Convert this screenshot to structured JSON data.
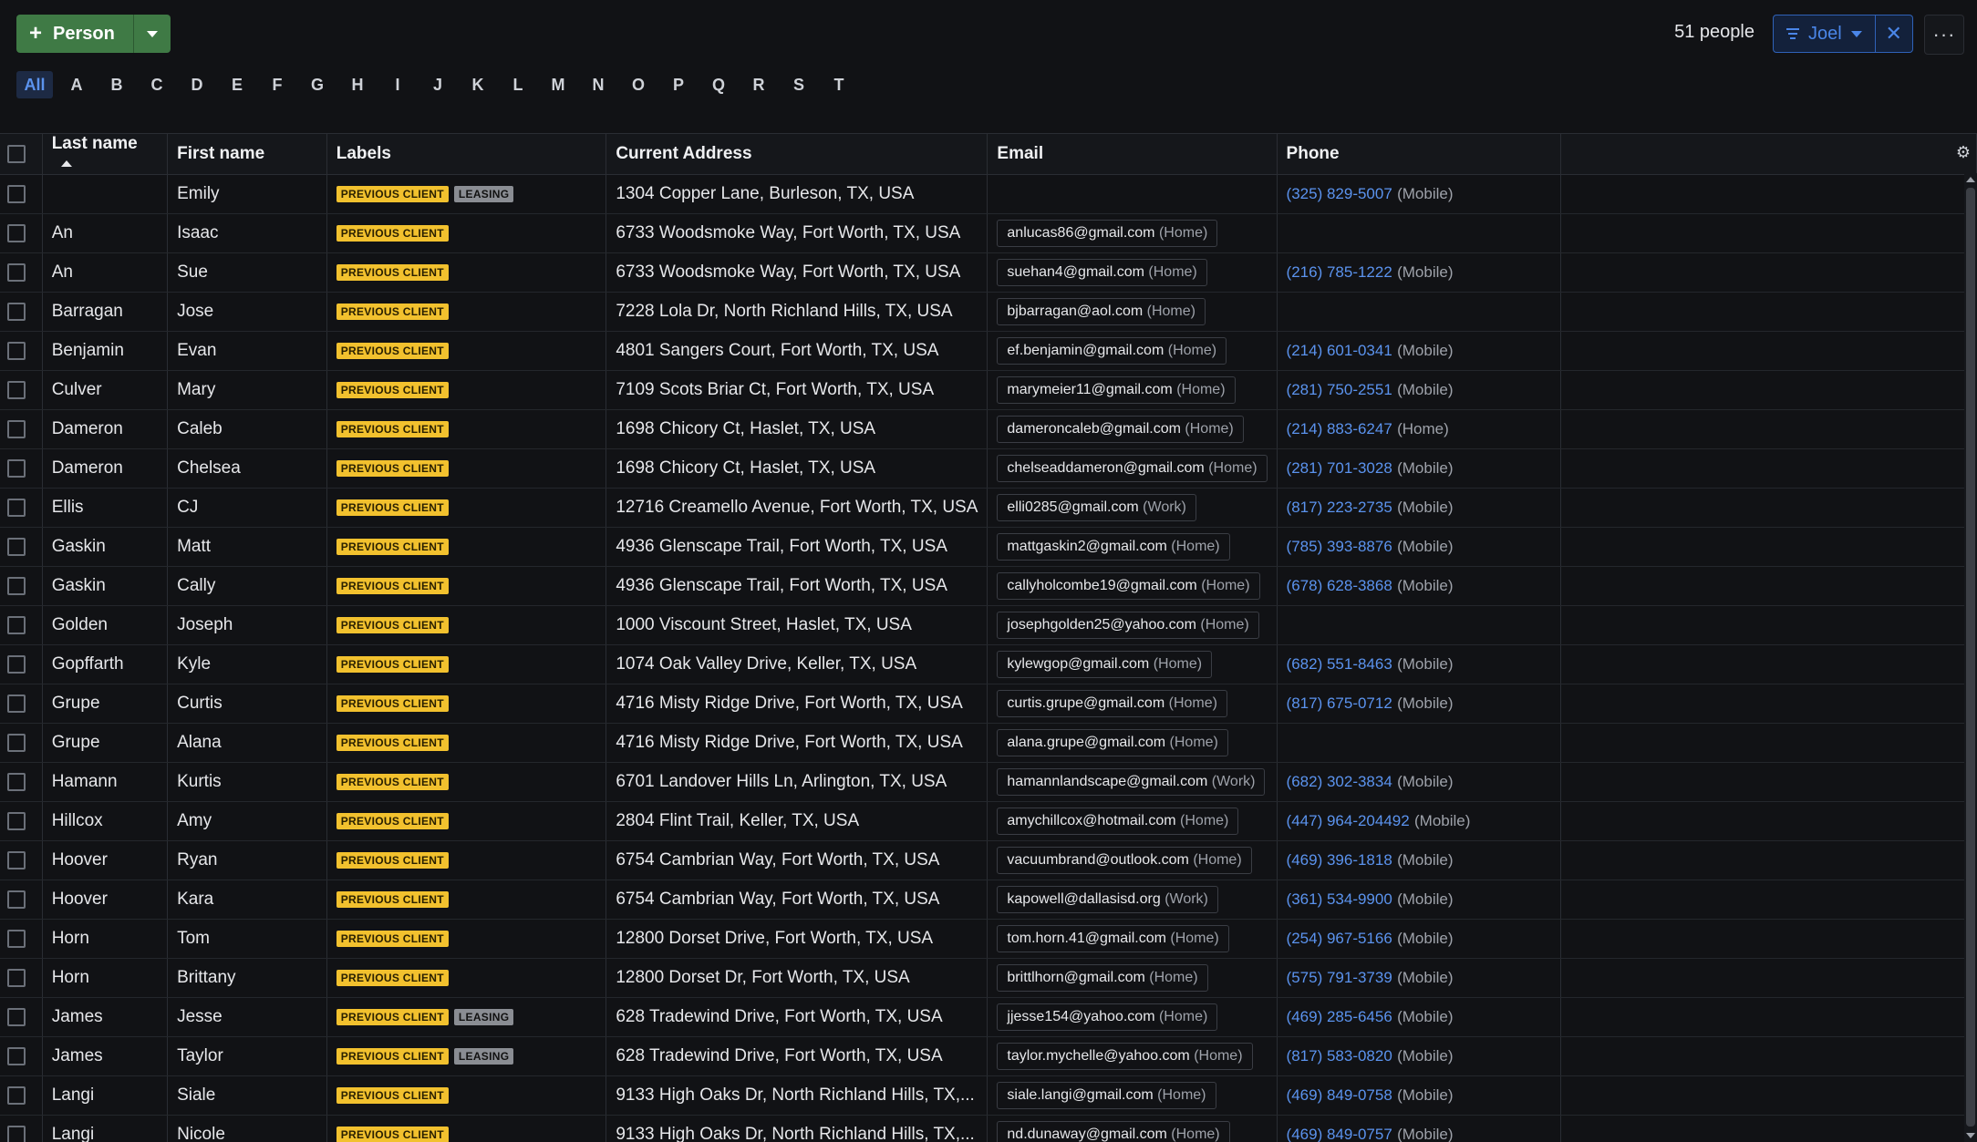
{
  "toolbar": {
    "add_person_label": "Person",
    "people_count": "51 people",
    "filter_label": "Joel",
    "clear_label": "✕",
    "more_label": "···"
  },
  "alphabet": [
    "All",
    "A",
    "B",
    "C",
    "D",
    "E",
    "F",
    "G",
    "H",
    "I",
    "J",
    "K",
    "L",
    "M",
    "N",
    "O",
    "P",
    "Q",
    "R",
    "S",
    "T"
  ],
  "alphabet_active": "All",
  "columns": {
    "last_name": "Last name",
    "first_name": "First name",
    "labels": "Labels",
    "address": "Current Address",
    "email": "Email",
    "phone": "Phone"
  },
  "rows": [
    {
      "last": "",
      "first": "Emily",
      "labels": [
        "PREVIOUS CLIENT",
        "LEASING"
      ],
      "address": "1304 Copper Lane, Burleson, TX, USA",
      "email": "",
      "email_type": "",
      "phone": "(325) 829-5007",
      "phone_type": "(Mobile)"
    },
    {
      "last": "An",
      "first": "Isaac",
      "labels": [
        "PREVIOUS CLIENT"
      ],
      "address": "6733 Woodsmoke Way, Fort Worth, TX, USA",
      "email": "anlucas86@gmail.com",
      "email_type": "(Home)",
      "phone": "",
      "phone_type": ""
    },
    {
      "last": "An",
      "first": "Sue",
      "labels": [
        "PREVIOUS CLIENT"
      ],
      "address": "6733 Woodsmoke Way, Fort Worth, TX, USA",
      "email": "suehan4@gmail.com",
      "email_type": "(Home)",
      "phone": "(216) 785-1222",
      "phone_type": "(Mobile)"
    },
    {
      "last": "Barragan",
      "first": "Jose",
      "labels": [
        "PREVIOUS CLIENT"
      ],
      "address": "7228 Lola Dr, North Richland Hills, TX, USA",
      "email": "bjbarragan@aol.com",
      "email_type": "(Home)",
      "phone": "",
      "phone_type": ""
    },
    {
      "last": "Benjamin",
      "first": "Evan",
      "labels": [
        "PREVIOUS CLIENT"
      ],
      "address": "4801 Sangers Court, Fort Worth, TX, USA",
      "email": "ef.benjamin@gmail.com",
      "email_type": "(Home)",
      "phone": "(214) 601-0341",
      "phone_type": "(Mobile)"
    },
    {
      "last": "Culver",
      "first": "Mary",
      "labels": [
        "PREVIOUS CLIENT"
      ],
      "address": "7109 Scots Briar Ct, Fort Worth, TX, USA",
      "email": "marymeier11@gmail.com",
      "email_type": "(Home)",
      "phone": "(281) 750-2551",
      "phone_type": "(Mobile)"
    },
    {
      "last": "Dameron",
      "first": "Caleb",
      "labels": [
        "PREVIOUS CLIENT"
      ],
      "address": "1698 Chicory Ct, Haslet, TX, USA",
      "email": "dameroncaleb@gmail.com",
      "email_type": "(Home)",
      "phone": "(214) 883-6247",
      "phone_type": "(Home)"
    },
    {
      "last": "Dameron",
      "first": "Chelsea",
      "labels": [
        "PREVIOUS CLIENT"
      ],
      "address": "1698 Chicory Ct, Haslet, TX, USA",
      "email": "chelseaddameron@gmail.com",
      "email_type": "(Home)",
      "phone": "(281) 701-3028",
      "phone_type": "(Mobile)"
    },
    {
      "last": "Ellis",
      "first": "CJ",
      "labels": [
        "PREVIOUS CLIENT"
      ],
      "address": "12716 Creamello Avenue, Fort Worth, TX, USA",
      "email": "elli0285@gmail.com",
      "email_type": "(Work)",
      "phone": "(817) 223-2735",
      "phone_type": "(Mobile)"
    },
    {
      "last": "Gaskin",
      "first": "Matt",
      "labels": [
        "PREVIOUS CLIENT"
      ],
      "address": "4936 Glenscape Trail, Fort Worth, TX, USA",
      "email": "mattgaskin2@gmail.com",
      "email_type": "(Home)",
      "phone": "(785) 393-8876",
      "phone_type": "(Mobile)"
    },
    {
      "last": "Gaskin",
      "first": "Cally",
      "labels": [
        "PREVIOUS CLIENT"
      ],
      "address": "4936 Glenscape Trail, Fort Worth, TX, USA",
      "email": "callyholcombe19@gmail.com",
      "email_type": "(Home)",
      "phone": "(678) 628-3868",
      "phone_type": "(Mobile)"
    },
    {
      "last": "Golden",
      "first": "Joseph",
      "labels": [
        "PREVIOUS CLIENT"
      ],
      "address": "1000 Viscount Street, Haslet, TX, USA",
      "email": "josephgolden25@yahoo.com",
      "email_type": "(Home)",
      "phone": "",
      "phone_type": ""
    },
    {
      "last": "Gopffarth",
      "first": "Kyle",
      "labels": [
        "PREVIOUS CLIENT"
      ],
      "address": "1074 Oak Valley Drive, Keller, TX, USA",
      "email": "kylewgop@gmail.com",
      "email_type": "(Home)",
      "phone": "(682) 551-8463",
      "phone_type": "(Mobile)"
    },
    {
      "last": "Grupe",
      "first": "Curtis",
      "labels": [
        "PREVIOUS CLIENT"
      ],
      "address": "4716 Misty Ridge Drive, Fort Worth, TX, USA",
      "email": "curtis.grupe@gmail.com",
      "email_type": "(Home)",
      "phone": "(817) 675-0712",
      "phone_type": "(Mobile)"
    },
    {
      "last": "Grupe",
      "first": "Alana",
      "labels": [
        "PREVIOUS CLIENT"
      ],
      "address": "4716 Misty Ridge Drive, Fort Worth, TX, USA",
      "email": "alana.grupe@gmail.com",
      "email_type": "(Home)",
      "phone": "",
      "phone_type": ""
    },
    {
      "last": "Hamann",
      "first": "Kurtis",
      "labels": [
        "PREVIOUS CLIENT"
      ],
      "address": "6701 Landover Hills Ln, Arlington, TX, USA",
      "email": "hamannlandscape@gmail.com",
      "email_type": "(Work)",
      "phone": "(682) 302-3834",
      "phone_type": "(Mobile)"
    },
    {
      "last": "Hillcox",
      "first": "Amy",
      "labels": [
        "PREVIOUS CLIENT"
      ],
      "address": "2804 Flint Trail, Keller, TX, USA",
      "email": "amychillcox@hotmail.com",
      "email_type": "(Home)",
      "phone": "(447) 964-204492",
      "phone_type": "(Mobile)"
    },
    {
      "last": "Hoover",
      "first": "Ryan",
      "labels": [
        "PREVIOUS CLIENT"
      ],
      "address": "6754 Cambrian Way, Fort Worth, TX, USA",
      "email": "vacuumbrand@outlook.com",
      "email_type": "(Home)",
      "phone": "(469) 396-1818",
      "phone_type": "(Mobile)"
    },
    {
      "last": "Hoover",
      "first": "Kara",
      "labels": [
        "PREVIOUS CLIENT"
      ],
      "address": "6754 Cambrian Way, Fort Worth, TX, USA",
      "email": "kapowell@dallasisd.org",
      "email_type": "(Work)",
      "phone": "(361) 534-9900",
      "phone_type": "(Mobile)"
    },
    {
      "last": "Horn",
      "first": "Tom",
      "labels": [
        "PREVIOUS CLIENT"
      ],
      "address": "12800 Dorset Drive, Fort Worth, TX, USA",
      "email": "tom.horn.41@gmail.com",
      "email_type": "(Home)",
      "phone": "(254) 967-5166",
      "phone_type": "(Mobile)"
    },
    {
      "last": "Horn",
      "first": "Brittany",
      "labels": [
        "PREVIOUS CLIENT"
      ],
      "address": "12800 Dorset Dr, Fort Worth, TX, USA",
      "email": "brittlhorn@gmail.com",
      "email_type": "(Home)",
      "phone": "(575) 791-3739",
      "phone_type": "(Mobile)"
    },
    {
      "last": "James",
      "first": "Jesse",
      "labels": [
        "PREVIOUS CLIENT",
        "LEASING"
      ],
      "address": "628 Tradewind Drive, Fort Worth, TX, USA",
      "email": "jjesse154@yahoo.com",
      "email_type": "(Home)",
      "phone": "(469) 285-6456",
      "phone_type": "(Mobile)"
    },
    {
      "last": "James",
      "first": "Taylor",
      "labels": [
        "PREVIOUS CLIENT",
        "LEASING"
      ],
      "address": "628 Tradewind Drive, Fort Worth, TX, USA",
      "email": "taylor.mychelle@yahoo.com",
      "email_type": "(Home)",
      "phone": "(817) 583-0820",
      "phone_type": "(Mobile)"
    },
    {
      "last": "Langi",
      "first": "Siale",
      "labels": [
        "PREVIOUS CLIENT"
      ],
      "address": "9133 High Oaks Dr, North Richland Hills, TX,...",
      "email": "siale.langi@gmail.com",
      "email_type": "(Home)",
      "phone": "(469) 849-0758",
      "phone_type": "(Mobile)"
    },
    {
      "last": "Langi",
      "first": "Nicole",
      "labels": [
        "PREVIOUS CLIENT"
      ],
      "address": "9133 High Oaks Dr, North Richland Hills, TX,...",
      "email": "nd.dunaway@gmail.com",
      "email_type": "(Home)",
      "phone": "(469) 849-0757",
      "phone_type": "(Mobile)"
    }
  ]
}
